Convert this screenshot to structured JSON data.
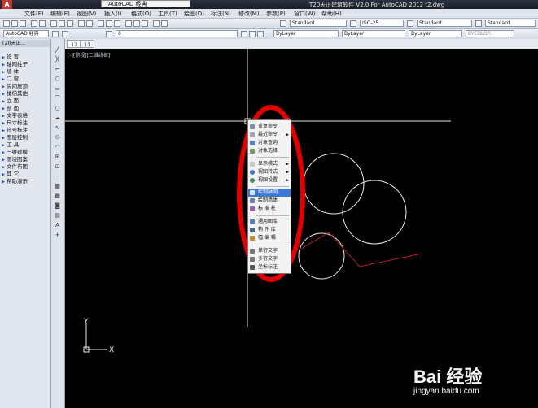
{
  "window": {
    "title": "T20天正建筑软件 V2.0 For AutoCAD 2012    t2.dwg",
    "workspace": "AutoCAD 经典"
  },
  "menu": [
    "文件(F)",
    "编辑(E)",
    "视图(V)",
    "插入(I)",
    "格式(O)",
    "工具(T)",
    "绘图(D)",
    "标注(N)",
    "修改(M)",
    "参数(P)",
    "窗口(W)",
    "帮助(H)"
  ],
  "toolbar": {
    "workspace_combo": "AutoCAD 经典",
    "layer_combo": "0",
    "text_style": "Standard",
    "dim_style": "ISO-25",
    "table_style": "Standard",
    "mleader_style": "Standard",
    "color_combo": "ByLayer",
    "linetype_combo": "ByLayer",
    "lineweight_combo": "ByLayer",
    "plotstyle_combo": "BYCOLOR"
  },
  "side_panel": {
    "title": "T20天正...",
    "items": [
      "设  置",
      "轴网柱子",
      "墙  体",
      "门  窗",
      "房间屋顶",
      "楼梯其他",
      "立  面",
      "剖  面",
      "文字表格",
      "尺寸标注",
      "符号标注",
      "图层控制",
      "工  具",
      "三维建模",
      "图块图案",
      "文件布图",
      "其  它",
      "帮助演示"
    ]
  },
  "tabs": [
    "12",
    "11"
  ],
  "viewport_label": "[-][俯视][二维线框]",
  "context_menu": {
    "items": [
      {
        "label": "重复命令",
        "icon": "repeat-icon",
        "submenu": false,
        "highlight": false
      },
      {
        "label": "最近命令",
        "icon": "recent-icon",
        "submenu": true,
        "highlight": false
      },
      {
        "label": "对象查询",
        "icon": "query-icon",
        "submenu": false,
        "highlight": false
      },
      {
        "label": "对象选择",
        "icon": "select-icon",
        "submenu": false,
        "highlight": false
      },
      {
        "label": "显示模式",
        "icon": "display-icon",
        "submenu": true,
        "highlight": false
      },
      {
        "label": "视图转式",
        "icon": "view-icon",
        "submenu": true,
        "highlight": false
      },
      {
        "label": "视图设置",
        "icon": "view-settings-icon",
        "submenu": true,
        "highlight": false
      },
      {
        "label": "绘制轴网",
        "icon": "axis-grid-icon",
        "submenu": false,
        "highlight": true
      },
      {
        "label": "绘制墙体",
        "icon": "wall-icon",
        "submenu": false,
        "highlight": false
      },
      {
        "label": "标 准 柱",
        "icon": "column-icon",
        "submenu": false,
        "highlight": false
      },
      {
        "label": "通用图库",
        "icon": "library-icon",
        "submenu": false,
        "highlight": false
      },
      {
        "label": "构 件 库",
        "icon": "component-icon",
        "submenu": false,
        "highlight": false
      },
      {
        "label": "幅 编 辑",
        "icon": "edit-icon",
        "submenu": false,
        "highlight": false
      },
      {
        "label": "单行文字",
        "icon": "single-text-icon",
        "submenu": false,
        "highlight": false
      },
      {
        "label": "多行文字",
        "icon": "multi-text-icon",
        "submenu": false,
        "highlight": false
      },
      {
        "label": "坐标标注",
        "icon": "coord-dim-icon",
        "submenu": false,
        "highlight": false
      }
    ]
  },
  "ucs": {
    "x_label": "X",
    "y_label": "Y"
  },
  "watermark": {
    "main": "Bai 经验",
    "url": "jingyan.baidu.com"
  },
  "colors": {
    "canvas": "#000000",
    "highlight": "#3c78d8",
    "annotation": "#e00000",
    "geometry": "#e8e8e8",
    "red_line": "#b22222"
  }
}
